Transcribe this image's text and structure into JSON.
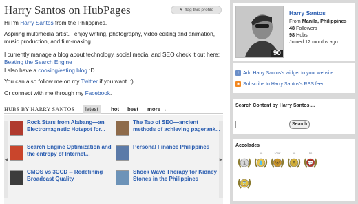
{
  "page": {
    "title": "Harry Santos on HubPages",
    "flag_label": "flag this profile"
  },
  "bio": {
    "p1_prefix": "Hi I'm ",
    "p1_link": "Harry Santos",
    "p1_suffix": " from the Philippines.",
    "p2": "Aspiring multimedia artist. I enjoy writing, photography, video editing and animation, music production, and film-making.",
    "p3_text": "I currently manage a blog about technology, social media, and SEO check it out here: ",
    "p3_link": "Beating the Search Engine",
    "p4_prefix": "I also have a ",
    "p4_link": "cooking/eating blog",
    "p4_suffix": "  :D",
    "p5_prefix": "You can also follow me on my ",
    "p5_link": "Twitter",
    "p5_suffix": " if you want. :)",
    "p6_prefix": "Or connect with me through my ",
    "p6_link": "Facebook",
    "p6_suffix": "."
  },
  "hubs": {
    "heading": "HUBS BY HARRY SANTOS",
    "tabs": [
      "latest",
      "hot",
      "best",
      "more →"
    ],
    "items": [
      {
        "title": "Rock Stars from Alabang—an Electromagnetic Hotspot for...",
        "thumb_color": "#b03a2e"
      },
      {
        "title": "The Tao of SEO—ancient methods of achieving pagerank...",
        "thumb_color": "#8e6b4a"
      },
      {
        "title": "Search Engine Optimization and the entropy of Internet...",
        "thumb_color": "#c9452c"
      },
      {
        "title": "Personal Finance Philippines",
        "thumb_color": "#5b7aa8"
      },
      {
        "title": "CMOS vs 3CCD -- Redefining Broadcast Quality",
        "thumb_color": "#3c3c3c"
      },
      {
        "title": "Shock Wave Therapy for Kidney Stones in the Philippines",
        "thumb_color": "#6d93b8"
      }
    ]
  },
  "profile": {
    "name": "Harry Santos",
    "from_label": "From ",
    "from_value": "Manila, Philippines",
    "followers_count": "48",
    "followers_label": " Followers",
    "hubs_count": "98",
    "hubs_label": " Hubs",
    "joined": "Joined 12 months ago",
    "score": "90"
  },
  "widgets": {
    "widget_link": "Add Harry Santos's widget to your website",
    "rss_link": "Subscribe to Harry Santos's RSS feed"
  },
  "search": {
    "heading": "Search Content by Harry Santos ...",
    "input_value": "",
    "button_label": "Search"
  },
  "accolades": {
    "heading": "Accolades",
    "items": [
      {
        "icon": "wreath-1",
        "top": "",
        "color": "#d8d8d8",
        "glyph": "1"
      },
      {
        "icon": "wreath-drop",
        "top": "50",
        "color": "#e9c34b",
        "glyph": "💧"
      },
      {
        "icon": "wreath-shield",
        "top": "100K",
        "color": "#c9952a",
        "glyph": "⛨"
      },
      {
        "icon": "wreath-a",
        "top": "50",
        "color": "#d4b13a",
        "glyph": "A"
      },
      {
        "icon": "wreath-comment",
        "top": "50",
        "color": "#c0392b",
        "glyph": "💬"
      },
      {
        "icon": "wreath-hourglass",
        "top": "",
        "color": "#e3c040",
        "glyph": "⌛"
      }
    ]
  }
}
